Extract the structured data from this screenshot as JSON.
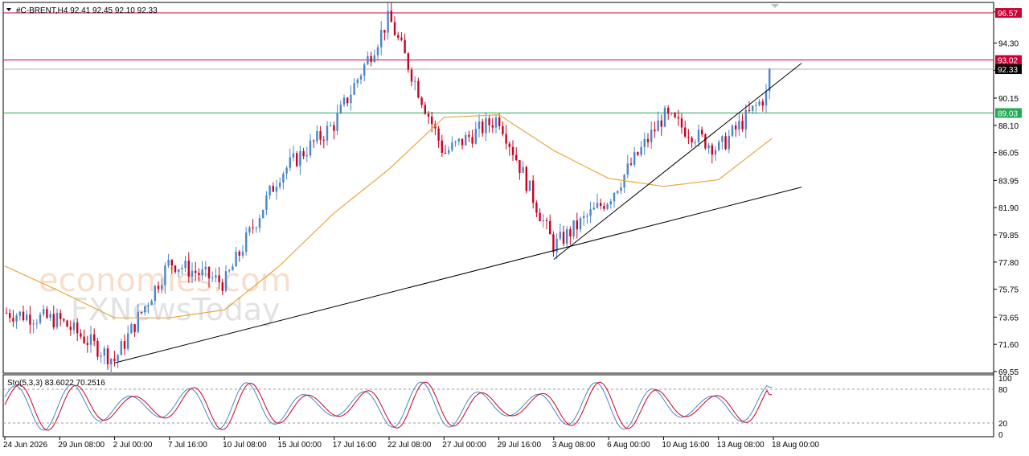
{
  "header": {
    "symbol_line": "#C-BRENT,H4  92.41 92.45 92.10 92.33",
    "collapse_icon": "triangle-down-icon"
  },
  "watermark": {
    "line1": "economies.com",
    "line2": "FXNewsToday"
  },
  "price_badges": [
    {
      "label": "96.57",
      "value": 96.57,
      "kind": "resistance",
      "color": "#cc0033"
    },
    {
      "label": "93.02",
      "value": 93.02,
      "kind": "resistance",
      "color": "#cc0033"
    },
    {
      "label": "92.33",
      "value": 92.33,
      "kind": "current",
      "color": "#000000"
    },
    {
      "label": "89.03",
      "value": 89.03,
      "kind": "support",
      "color": "#22aa55"
    }
  ],
  "colors": {
    "bull": "#4a86c8",
    "bear": "#cc0022",
    "ma": "#e8a840",
    "resistance": "#cc0033",
    "support": "#22aa55",
    "stoch_main": "#4a86c8",
    "stoch_signal": "#cc0022"
  },
  "chart_data": {
    "type": "candlestick",
    "title": "#C-BRENT,H4",
    "ohlc_last": {
      "open": 92.41,
      "high": 92.45,
      "low": 92.1,
      "close": 92.33
    },
    "ylim": [
      69.55,
      97.3
    ],
    "y_ticks": [
      "96.65",
      "94.30",
      "92.25",
      "90.15",
      "88.10",
      "86.05",
      "83.95",
      "81.90",
      "79.85",
      "77.80",
      "75.75",
      "73.65",
      "71.60",
      "69.55"
    ],
    "x_ticks": [
      "24 Jun 2026",
      "29 Jun 08:00",
      "2 Jul 00:00",
      "7 Jul 16:00",
      "10 Jul 08:00",
      "15 Jul 00:00",
      "17 Jul 16:00",
      "22 Jul 08:00",
      "27 Jul 00:00",
      "29 Jul 16:00",
      "3 Aug 08:00",
      "6 Aug 00:00",
      "10 Aug 16:00",
      "13 Aug 08:00",
      "18 Aug 00:00"
    ],
    "horizontal_levels": [
      96.57,
      93.02,
      89.03
    ],
    "trendlines": [
      {
        "from": [
          "2 Jul 00:00",
          70.2
        ],
        "to": [
          "18 Aug 00:00",
          82.9
        ]
      },
      {
        "from": [
          "3 Aug 08:00",
          78.0
        ],
        "to": [
          "18 Aug 00:00",
          91.1
        ]
      }
    ],
    "close_path": [
      [
        "24 Jun 2026",
        74.0
      ],
      [
        "29 Jun 08:00",
        73.4
      ],
      [
        "2 Jul 00:00",
        70.4
      ],
      [
        "7 Jul 16:00",
        77.8
      ],
      [
        "10 Jul 08:00",
        76.2
      ],
      [
        "15 Jul 00:00",
        84.4
      ],
      [
        "17 Jul 16:00",
        88.2
      ],
      [
        "22 Jul 08:00",
        96.2
      ],
      [
        "27 Jul 00:00",
        86.0
      ],
      [
        "29 Jul 16:00",
        88.7
      ],
      [
        "3 Aug 08:00",
        79.0
      ],
      [
        "6 Aug 00:00",
        82.6
      ],
      [
        "10 Aug 16:00",
        88.8
      ],
      [
        "13 Aug 08:00",
        86.3
      ],
      [
        "18 Aug 00:00",
        91.0
      ]
    ],
    "ma_path": [
      [
        "24 Jun 2026",
        77.5
      ],
      [
        "29 Jun 08:00",
        75.6
      ],
      [
        "2 Jul 00:00",
        73.6
      ],
      [
        "7 Jul 16:00",
        73.6
      ],
      [
        "10 Jul 08:00",
        74.2
      ],
      [
        "15 Jul 00:00",
        77.5
      ],
      [
        "17 Jul 16:00",
        81.5
      ],
      [
        "22 Jul 08:00",
        84.8
      ],
      [
        "27 Jul 00:00",
        88.7
      ],
      [
        "29 Jul 16:00",
        88.9
      ],
      [
        "3 Aug 08:00",
        86.2
      ],
      [
        "6 Aug 00:00",
        84.1
      ],
      [
        "10 Aug 16:00",
        83.5
      ],
      [
        "13 Aug 08:00",
        84.0
      ],
      [
        "18 Aug 00:00",
        87.2
      ]
    ],
    "stochastic": {
      "label": "Sto(5,3,3) 83.6022 70.2516",
      "main": 83.6022,
      "signal": 70.2516,
      "ylim": [
        0,
        100
      ],
      "y_ticks": [
        "100",
        "80",
        "20",
        "0"
      ],
      "levels": [
        80,
        20
      ]
    }
  }
}
